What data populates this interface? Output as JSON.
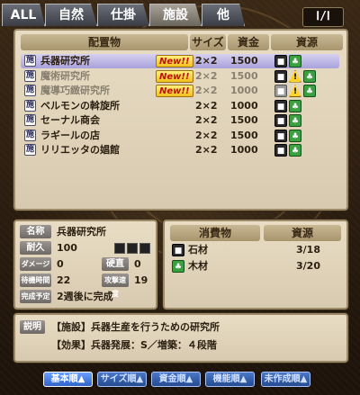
{
  "tabs": [
    "ALL",
    "自然",
    "仕掛",
    "施設",
    "他"
  ],
  "active_tab": 3,
  "counter": "Ⅰ/Ⅰ",
  "list_headers": {
    "name": "配置物",
    "size": "サイズ",
    "cost": "資金",
    "resource": "資源"
  },
  "rows": [
    {
      "name": "兵器研究所",
      "badge": "New!!",
      "size": "2×2",
      "cost": "1500",
      "resources": [
        "stone",
        "wood"
      ]
    },
    {
      "name": "魔術研究所",
      "badge": "New!!",
      "size": "2×2",
      "cost": "1500",
      "resources": [
        "stone",
        "warn",
        "wood"
      ]
    },
    {
      "name": "魔導巧緻研究所",
      "badge": "New!!",
      "size": "2×2",
      "cost": "1000",
      "resources": [
        "gray",
        "warn",
        "wood"
      ]
    },
    {
      "name": "ベルモンの斡旋所",
      "badge": "",
      "size": "2×2",
      "cost": "1000",
      "resources": [
        "stone",
        "wood"
      ]
    },
    {
      "name": "セーナル商会",
      "badge": "",
      "size": "2×2",
      "cost": "1500",
      "resources": [
        "stone",
        "wood"
      ]
    },
    {
      "name": "ラギールの店",
      "badge": "",
      "size": "2×2",
      "cost": "1500",
      "resources": [
        "stone",
        "wood"
      ]
    },
    {
      "name": "リリエッタの娼館",
      "badge": "",
      "size": "2×2",
      "cost": "1000",
      "resources": [
        "stone",
        "wood"
      ]
    }
  ],
  "detail": {
    "name_label": "名称",
    "name": "兵器研究所",
    "hp_label": "耐久",
    "hp": "100",
    "dmg_label": "ダメージ",
    "dmg": "0",
    "hard_label": "硬直",
    "hard": "0",
    "wait_label": "待機時間",
    "wait": "22",
    "speed_label": "攻撃速度",
    "speed": "19",
    "complete_label": "完成予定",
    "complete": "2週後に完成"
  },
  "consumption": {
    "header_item": "消費物",
    "header_amount": "資源",
    "items": [
      {
        "name": "石材",
        "amount": "3/18",
        "kind": "stone"
      },
      {
        "name": "木材",
        "amount": "3/20",
        "kind": "wood"
      }
    ]
  },
  "description": {
    "label": "説明",
    "line1": "【施設】兵器生産を行うための研究所",
    "line2": "【効果】兵器発展：S／増築：４段階"
  },
  "sort_buttons": [
    "基本順▲",
    "サイズ順▲",
    "資金順▲",
    "機能順▲",
    "未作成順▲"
  ],
  "active_sort": 0
}
